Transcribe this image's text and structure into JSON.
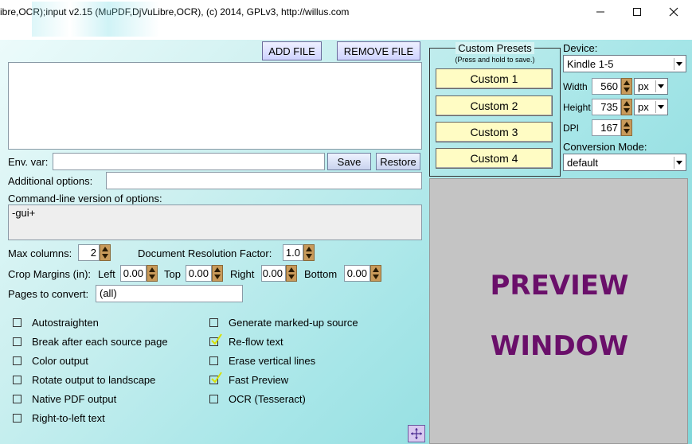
{
  "window": {
    "title": "ibre,OCR);input v2.15 (MuPDF,DjVuLibre,OCR), (c) 2014, GPLv3, http://willus.com"
  },
  "toolbar": {
    "add_file": "ADD FILE",
    "remove_file": "REMOVE FILE"
  },
  "env": {
    "label": "Env. var:",
    "value": "",
    "save": "Save",
    "restore": "Restore"
  },
  "additional_options": {
    "label": "Additional options:",
    "value": ""
  },
  "cmdline": {
    "label": "Command-line version of options:",
    "value": "-gui+"
  },
  "max_columns": {
    "label": "Max columns:",
    "value": "2"
  },
  "doc_res": {
    "label": "Document Resolution Factor:",
    "value": "1.0"
  },
  "crop": {
    "label": "Crop Margins (in):",
    "left_label": "Left",
    "left": "0.00",
    "top_label": "Top",
    "top": "0.00",
    "right_label": "Right",
    "right": "0.00",
    "bottom_label": "Bottom",
    "bottom": "0.00"
  },
  "pages": {
    "label": "Pages to convert:",
    "value": "(all)"
  },
  "checkboxes_left": [
    {
      "label": "Autostraighten",
      "checked": false
    },
    {
      "label": "Break after each source page",
      "checked": false
    },
    {
      "label": "Color output",
      "checked": false
    },
    {
      "label": "Rotate output to landscape",
      "checked": false
    },
    {
      "label": "Native PDF output",
      "checked": false
    },
    {
      "label": "Right-to-left text",
      "checked": false
    }
  ],
  "checkboxes_right": [
    {
      "label": "Generate marked-up source",
      "checked": false
    },
    {
      "label": "Re-flow text",
      "checked": true
    },
    {
      "label": "Erase vertical lines",
      "checked": false
    },
    {
      "label": "Fast Preview",
      "checked": true
    },
    {
      "label": "OCR (Tesseract)",
      "checked": false
    }
  ],
  "presets": {
    "title": "Custom Presets",
    "subtitle": "(Press and hold to save.)",
    "items": [
      "Custom 1",
      "Custom 2",
      "Custom 3",
      "Custom 4"
    ]
  },
  "device": {
    "label": "Device:",
    "value": "Kindle 1-5",
    "width_label": "Width",
    "width": "560",
    "width_unit": "px",
    "height_label": "Height",
    "height": "735",
    "height_unit": "px",
    "dpi_label": "DPI",
    "dpi": "167"
  },
  "conversion": {
    "label": "Conversion Mode:",
    "value": "default"
  },
  "preview": {
    "line1": "PREVIEW",
    "line2": "WINDOW"
  },
  "colors": {
    "preview_text": "#6a0f6a",
    "preset_button": "#fffcc4",
    "check": "#d8e000"
  }
}
